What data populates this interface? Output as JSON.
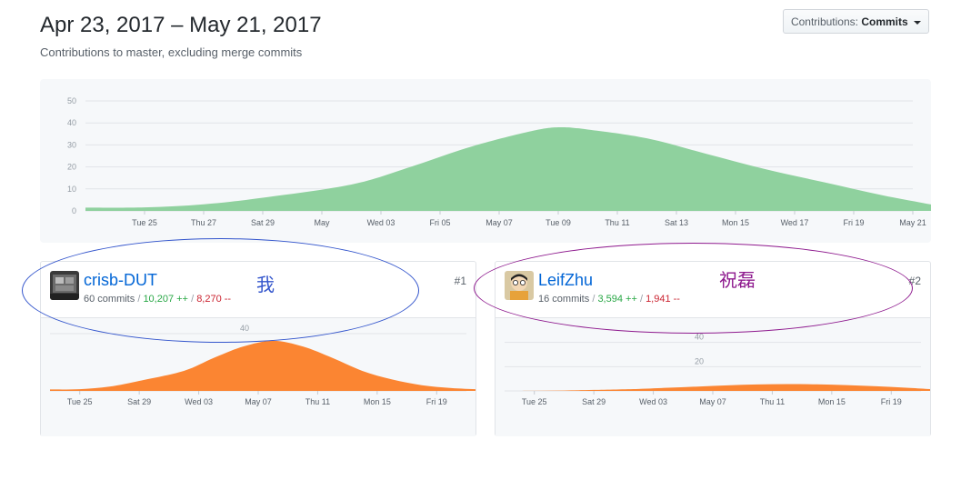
{
  "header": {
    "title": "Apr 23, 2017 – May 21, 2017",
    "subtitle": "Contributions to master, excluding merge commits",
    "dropdown_prefix": "Contributions:",
    "dropdown_value": "Commits"
  },
  "colors": {
    "main_area": "#8fd19e",
    "user_area": "#fb8532",
    "link": "#0366d6",
    "additions": "#28a745",
    "deletions": "#cb2431",
    "ellipse_user1": "#3355cc",
    "ellipse_user2": "#8e1a8e"
  },
  "chart_data": [
    {
      "type": "area",
      "y_ticks": [
        "50",
        "40",
        "30",
        "20",
        "10",
        "0"
      ],
      "ylim": [
        0,
        50
      ],
      "x_ticks": [
        "Tue 25",
        "Thu 27",
        "Sat 29",
        "May",
        "Wed 03",
        "Fri 05",
        "May 07",
        "Tue 09",
        "Thu 11",
        "Sat 13",
        "Mon 15",
        "Wed 17",
        "Fri 19",
        "May 21"
      ],
      "x": [
        "Apr 23",
        "Apr 25",
        "Apr 27",
        "Apr 29",
        "May 01",
        "May 03",
        "May 05",
        "May 07",
        "May 08",
        "May 09",
        "May 11",
        "May 13",
        "May 15",
        "May 17",
        "May 19",
        "May 21"
      ],
      "values": [
        1.5,
        1.6,
        3,
        6,
        12,
        20,
        29,
        36,
        38,
        37,
        33,
        26,
        19,
        13,
        7,
        2
      ],
      "grid": true
    },
    {
      "type": "area",
      "y_ticks": [
        "40"
      ],
      "x_ticks": [
        "Tue 25",
        "Sat 29",
        "Wed 03",
        "May 07",
        "Thu 11",
        "Mon 15",
        "Fri 19"
      ],
      "x": [
        "Apr 23",
        "Apr 25",
        "Apr 27",
        "Apr 29",
        "May 01",
        "May 03",
        "May 05",
        "May 07",
        "May 09",
        "May 11",
        "May 13",
        "May 15",
        "May 17",
        "May 19",
        "May 21"
      ],
      "values": [
        1,
        1.2,
        3,
        7,
        14,
        23,
        31,
        35,
        31,
        23,
        14,
        8,
        4,
        2,
        1
      ],
      "ylim": [
        0,
        40
      ],
      "grid": true
    },
    {
      "type": "area",
      "y_ticks": [
        "40",
        "20"
      ],
      "x_ticks": [
        "Tue 25",
        "Sat 29",
        "Wed 03",
        "May 07",
        "Thu 11",
        "Mon 15",
        "Fri 19"
      ],
      "x": [
        "Apr 23",
        "Apr 25",
        "Apr 27",
        "Apr 29",
        "May 01",
        "May 03",
        "May 05",
        "May 07",
        "May 09",
        "May 11",
        "May 13",
        "May 15",
        "May 17",
        "May 19",
        "May 21"
      ],
      "values": [
        0,
        0.1,
        0.3,
        0.8,
        1.6,
        2.6,
        3.6,
        4.6,
        5.3,
        5.6,
        5.4,
        4.8,
        3.8,
        2.6,
        1.2
      ],
      "ylim": [
        0,
        60
      ],
      "grid": true
    }
  ],
  "contributors": [
    {
      "name": "crisb-DUT",
      "commits": "60 commits",
      "additions": "10,207 ++",
      "deletions": "8,270 --",
      "rank": "#1",
      "annotation": "我"
    },
    {
      "name": "LeifZhu",
      "commits": "16 commits",
      "additions": "3,594 ++",
      "deletions": "1,941 --",
      "rank": "#2",
      "annotation": "祝磊"
    }
  ]
}
